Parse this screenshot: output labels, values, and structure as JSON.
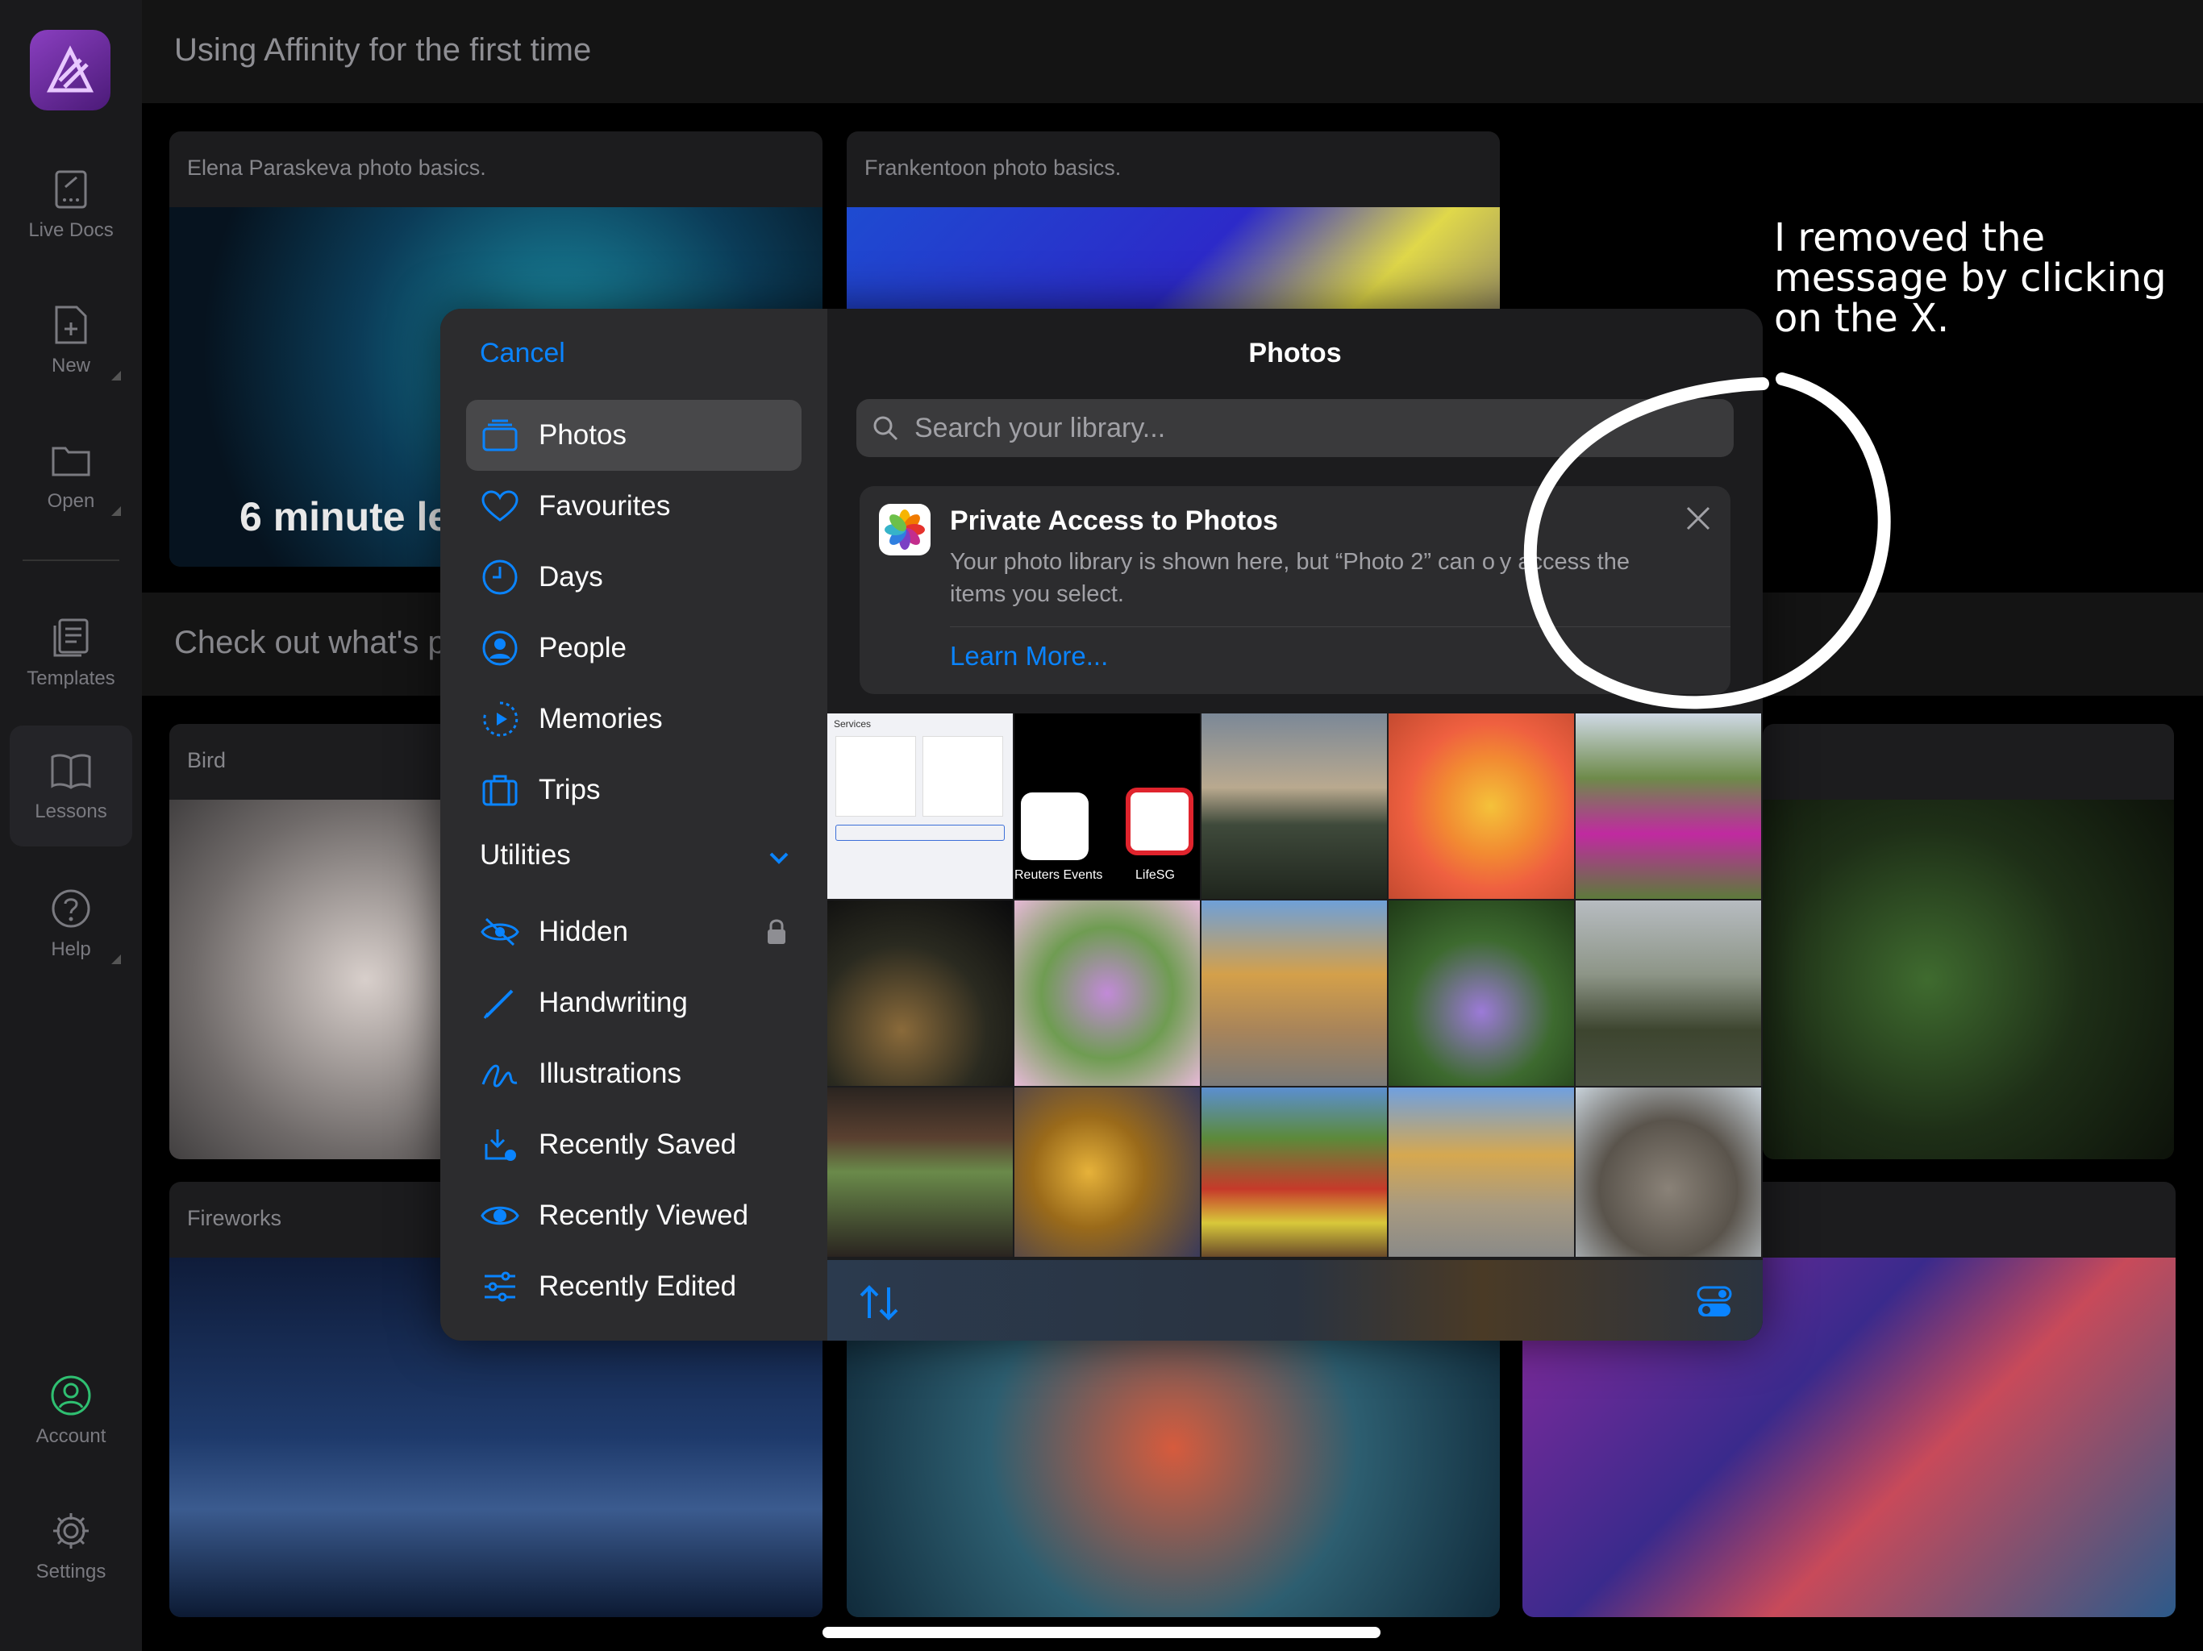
{
  "rail": {
    "items": [
      {
        "label": "Live Docs",
        "icon": "document-icon"
      },
      {
        "label": "New",
        "icon": "new-document-icon"
      },
      {
        "label": "Open",
        "icon": "folder-icon"
      },
      {
        "label": "Templates",
        "icon": "templates-icon"
      },
      {
        "label": "Lessons",
        "icon": "book-icon"
      },
      {
        "label": "Help",
        "icon": "question-icon"
      },
      {
        "label": "Account",
        "icon": "account-icon"
      },
      {
        "label": "Settings",
        "icon": "gear-icon"
      }
    ]
  },
  "main": {
    "header_title": "Using Affinity for the first time",
    "section_title": "Check out what's p",
    "cards": {
      "c1": "Elena Paraskeva photo basics.",
      "c2": "Frankentoon photo basics.",
      "c3": "Bird",
      "c4": "Fireworks"
    },
    "overlay_text": "6 minute le"
  },
  "picker": {
    "cancel": "Cancel",
    "title": "Photos",
    "search_placeholder": "Search your library...",
    "sidebar": {
      "items": [
        {
          "label": "Photos",
          "icon": "photos-stack-icon"
        },
        {
          "label": "Favourites",
          "icon": "heart-icon"
        },
        {
          "label": "Days",
          "icon": "clock-icon"
        },
        {
          "label": "People",
          "icon": "person-circle-icon"
        },
        {
          "label": "Memories",
          "icon": "memories-play-icon"
        },
        {
          "label": "Trips",
          "icon": "suitcase-icon"
        }
      ],
      "utilities_label": "Utilities",
      "utilities": [
        {
          "label": "Hidden",
          "icon": "eye-slash-icon"
        },
        {
          "label": "Handwriting",
          "icon": "pencil-icon"
        },
        {
          "label": "Illustrations",
          "icon": "scribble-icon"
        },
        {
          "label": "Recently Saved",
          "icon": "download-tray-icon"
        },
        {
          "label": "Recently Viewed",
          "icon": "eye-icon"
        },
        {
          "label": "Recently Edited",
          "icon": "sliders-icon"
        }
      ]
    },
    "notice": {
      "title": "Private Access to Photos",
      "body": "Your photo library is shown here, but “Photo 2” can o y access the items you select.",
      "link": "Learn More..."
    },
    "thumb_labels": {
      "services": "Services",
      "reuters": "Reuters Events",
      "lifesg": "LifeSG"
    }
  },
  "annotation": {
    "text": "I removed the message by clicking on the X."
  },
  "colors": {
    "accent": "#0a84ff",
    "sidebar_bg": "#2c2c2e",
    "content_bg": "#1c1c1e"
  }
}
